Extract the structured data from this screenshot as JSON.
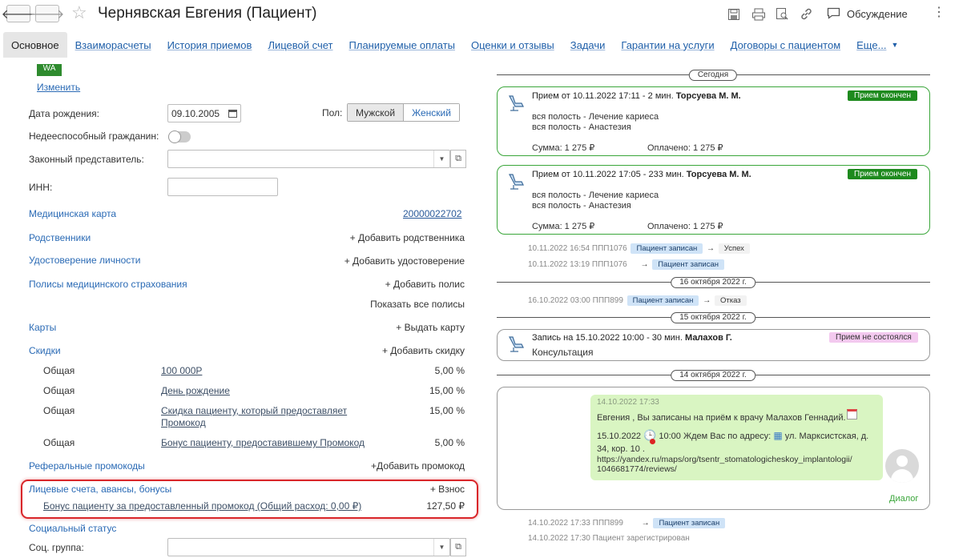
{
  "window": {
    "title": "Чернявская Евгения (Пациент)",
    "discussion_label": "Обсуждение"
  },
  "tabs": [
    "Основное",
    "Взаиморасчеты",
    "История приемов",
    "Лицевой счет",
    "Планируемые оплаты",
    "Оценки и отзывы",
    "Задачи",
    "Гарантии на услуги",
    "Договоры с пациентом",
    "Еще..."
  ],
  "left": {
    "photo_initials": "WA",
    "change_link": "Изменить",
    "birth_label": "Дата рождения:",
    "birth_value": "09.10.2005",
    "gender_label": "Пол:",
    "gender_male": "Мужской",
    "gender_female": "Женский",
    "incapable_label": "Недееспособный гражданин:",
    "legal_rep_label": "Законный представитель:",
    "inn_label": "ИНН:",
    "medcard_label": "Медицинская карта",
    "medcard_value": "20000022702",
    "relatives_label": "Родственники",
    "relatives_add": "+ Добавить родственника",
    "id_label": "Удостоверение личности",
    "id_add": "+ Добавить удостоверение",
    "policies_label": "Полисы медицинского страхования",
    "policies_add": "+ Добавить полис",
    "policies_show": "Показать все полисы",
    "cards_label": "Карты",
    "cards_add": "+ Выдать карту",
    "discounts_label": "Скидки",
    "discounts_add": "+ Добавить скидку",
    "discounts": [
      {
        "type": "Общая",
        "name": "100 000Р",
        "pct": "5,00 %"
      },
      {
        "type": "Общая",
        "name": "День рождение",
        "pct": "15,00 %"
      },
      {
        "type": "Общая",
        "name": "Скидка пациенту, который предоставляет",
        "name2": "Промокод",
        "pct": "15,00 %"
      },
      {
        "type": "Общая",
        "name": "Бонус пациенту, предоставившему Промокод",
        "pct": "5,00 %"
      }
    ],
    "referral_label": "Реферальные промокоды",
    "referral_add": "+Добавить промокод",
    "accounts_label": "Лицевые счета, авансы, бонусы",
    "accounts_add": "+ Взнос",
    "bonus_name": "Бонус пациенту за предоставленный промокод (Общий расход: 0,00 ₽)",
    "bonus_amount": "127,50 ₽",
    "social_label": "Социальный статус",
    "soc_group_label": "Соц. группа:"
  },
  "timeline": {
    "today_label": "Сегодня",
    "visit1": {
      "head": "Прием от 10.11.2022 17:11 - 2 мин.",
      "doctor": "Торсуева М. М.",
      "badge": "Прием окончен",
      "line1": "вся полость - Лечение кариеса",
      "line2": "вся полость - Анастезия",
      "sum": "Сумма: 1 275 ₽",
      "paid": "Оплачено: 1 275 ₽"
    },
    "visit2": {
      "head": "Прием от 10.11.2022 17:05 - 233 мин.",
      "doctor": "Торсуева М. М.",
      "badge": "Прием окончен",
      "line1": "вся полость - Лечение кариеса",
      "line2": "вся полость - Анастезия",
      "sum": "Сумма: 1 275 ₽",
      "paid": "Оплачено: 1 275 ₽"
    },
    "hist1": {
      "date": "10.11.2022 16:54 ППП1076",
      "tag": "Пациент записан",
      "result": "Успех"
    },
    "hist2": {
      "date": "10.11.2022 13:19 ППП1076",
      "tag": "Пациент записан"
    },
    "date_oct16": "16 октября 2022 г.",
    "hist3": {
      "date": "16.10.2022 03:00 ППП899",
      "tag": "Пациент записан",
      "result": "Отказ"
    },
    "date_oct15": "15 октября 2022 г.",
    "visit3": {
      "head": "Запись на 15.10.2022 10:00 - 30 мин.",
      "doctor": "Малахов Г.",
      "badge": "Прием не состоялся",
      "line1": "Консультация"
    },
    "date_oct14": "14 октября 2022 г.",
    "message": {
      "time": "14.10.2022 17:33",
      "line1": "Евгения , Вы записаны на приём к врачу Малахов Геннадий.",
      "line2a": "15.10.2022",
      "line2b": "10:00 Ждем Вас по адресу:",
      "line2c": "ул. Марксистская, д.",
      "line3": "34, кор. 10 .",
      "line4": "https://yandex.ru/maps/org/tsentr_stomatologicheskoy_implantologii/",
      "line5": "1046681774/reviews/",
      "dialog": "Диалог"
    },
    "hist4": {
      "date": "14.10.2022 17:33 ППП899",
      "tag": "Пациент записан"
    },
    "hist5": {
      "text": "14.10.2022 17:30 Пациент зарегистрирован"
    }
  },
  "colors": {
    "link": "#2a6ab5",
    "green_border": "#3aa63a",
    "badge_green": "#1e8a1e",
    "badge_pink": "#f3c9ef",
    "highlight": "#d9262a"
  }
}
